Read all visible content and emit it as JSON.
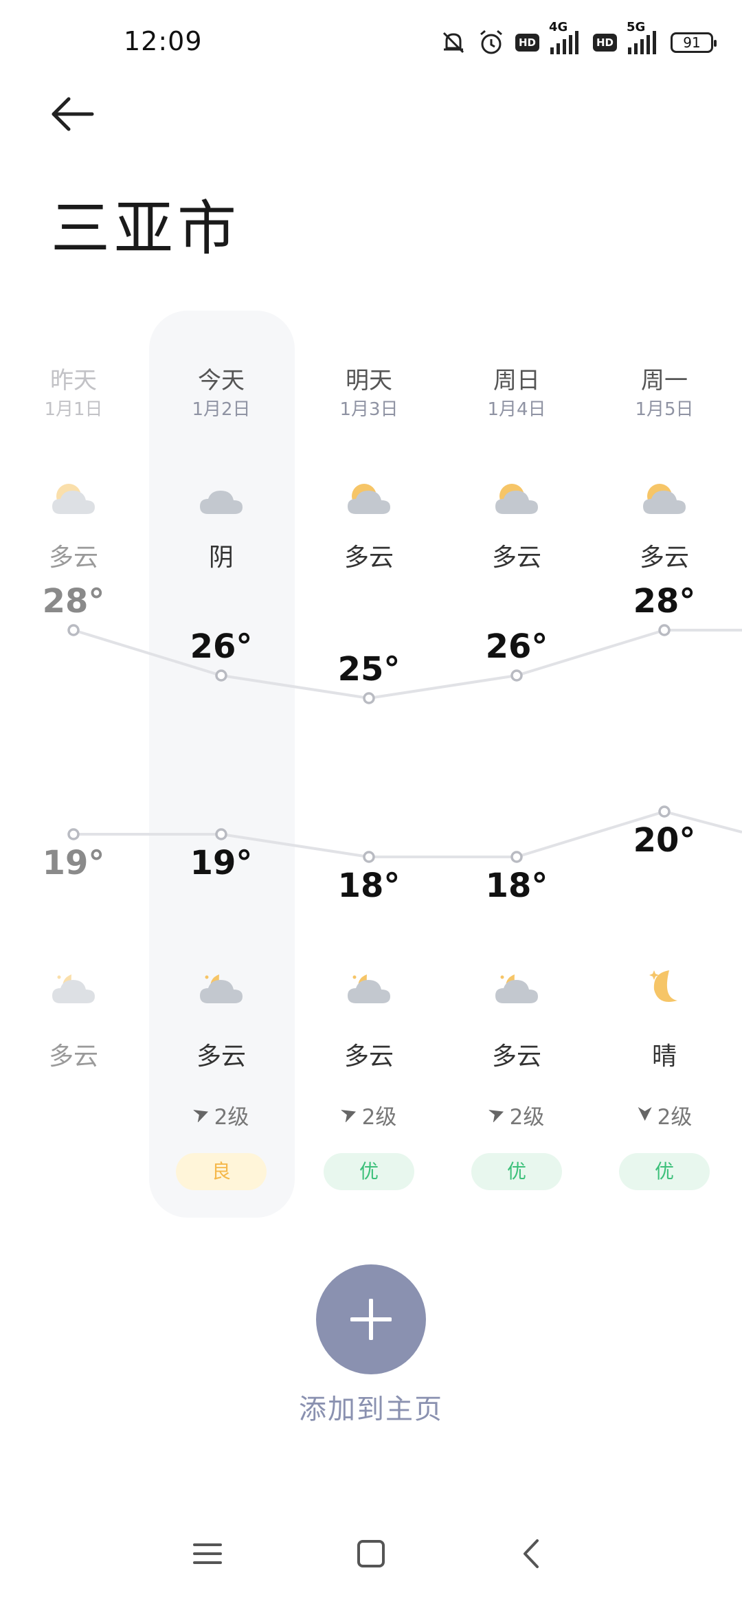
{
  "status_bar": {
    "time": "12:09",
    "network_1": "4G",
    "network_2": "5G",
    "hd_label": "HD",
    "battery": "91",
    "icons": [
      "bell-muted-icon",
      "alarm-icon",
      "hd-badge",
      "signal-icon",
      "hd-badge",
      "signal-icon",
      "battery-icon"
    ]
  },
  "page": {
    "back_icon": "arrow-left-icon",
    "title": "三亚市"
  },
  "forecast": [
    {
      "name": "昨天",
      "date": "1月1日",
      "day_cond": "多云",
      "day_icon": "partly-cloudy-day-icon",
      "high": "28°",
      "low": "19°",
      "night_icon": "partly-cloudy-night-icon",
      "night_cond": "多云",
      "wind": "",
      "aqi": "",
      "past": true
    },
    {
      "name": "今天",
      "date": "1月2日",
      "day_cond": "阴",
      "day_icon": "cloudy-icon",
      "high": "26°",
      "low": "19°",
      "night_icon": "partly-cloudy-night-icon",
      "night_cond": "多云",
      "wind": "2级",
      "aqi": "良",
      "past": false
    },
    {
      "name": "明天",
      "date": "1月3日",
      "day_cond": "多云",
      "day_icon": "partly-cloudy-day-icon",
      "high": "25°",
      "low": "18°",
      "night_icon": "partly-cloudy-night-icon",
      "night_cond": "多云",
      "wind": "2级",
      "aqi": "优",
      "past": false
    },
    {
      "name": "周日",
      "date": "1月4日",
      "day_cond": "多云",
      "day_icon": "partly-cloudy-day-icon",
      "high": "26°",
      "low": "18°",
      "night_icon": "partly-cloudy-night-icon",
      "night_cond": "多云",
      "wind": "2级",
      "aqi": "优",
      "past": false
    },
    {
      "name": "周一",
      "date": "1月5日",
      "day_cond": "多云",
      "day_icon": "partly-cloudy-day-icon",
      "high": "28°",
      "low": "20°",
      "night_icon": "clear-night-icon",
      "night_cond": "晴",
      "wind": "2级",
      "aqi": "优",
      "past": false
    }
  ],
  "chart_data": {
    "type": "line",
    "categories": [
      "昨天",
      "今天",
      "明天",
      "周日",
      "周一"
    ],
    "series": [
      {
        "values": [
          28,
          26,
          25,
          26,
          28
        ]
      },
      {
        "values": [
          19,
          19,
          18,
          18,
          20
        ]
      }
    ]
  },
  "colors": {
    "aqi_good": "#f5b84a",
    "aqi_good_bg": "#fff5d9",
    "aqi_excellent": "#3cc07a",
    "aqi_excellent_bg": "#e8f7ee",
    "accent": "#8a91b0"
  },
  "add_to_home": {
    "icon": "plus-icon",
    "label": "添加到主页"
  },
  "nav_bar": {
    "icons": [
      "menu-icon",
      "home-square-icon",
      "back-chevron-icon"
    ]
  }
}
